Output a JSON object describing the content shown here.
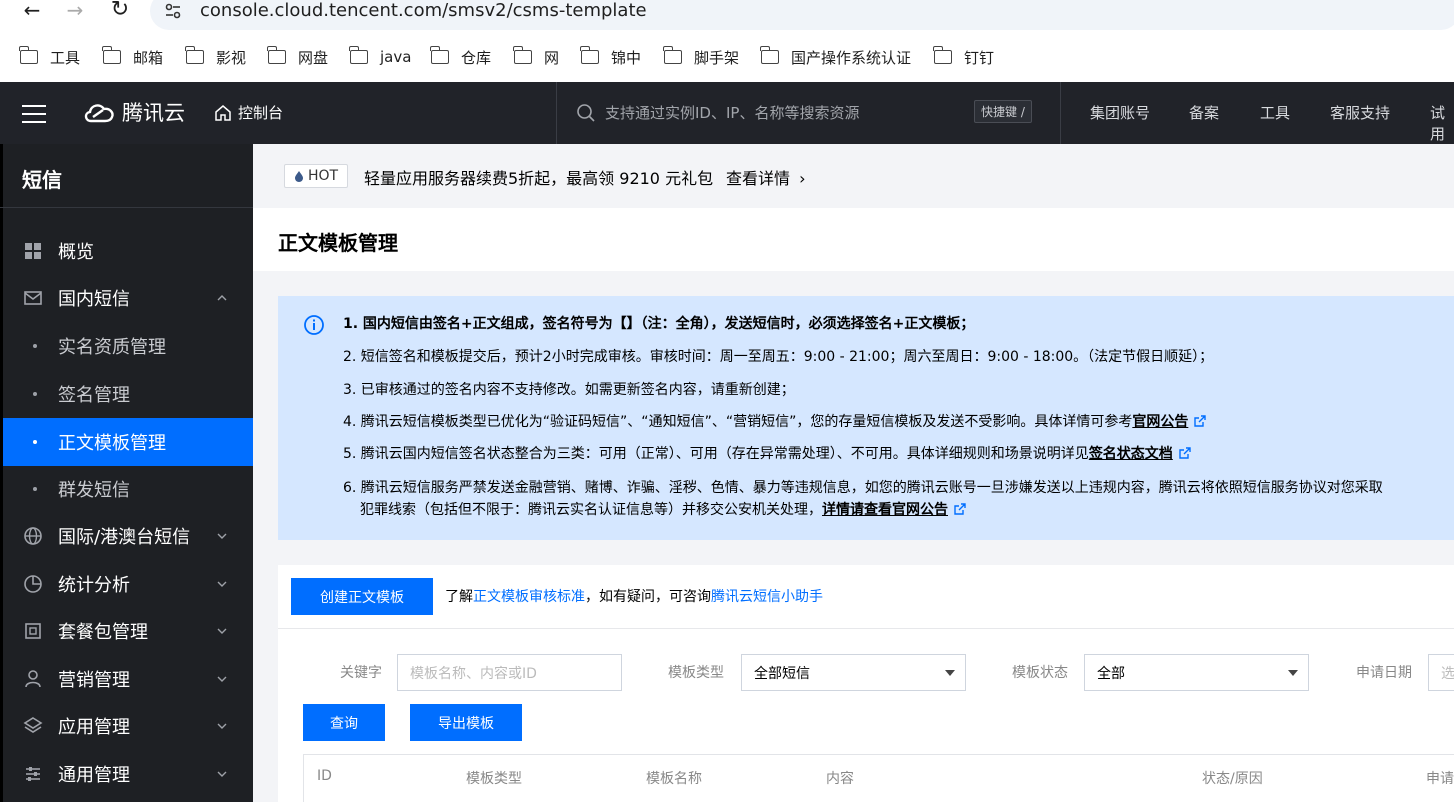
{
  "browser": {
    "url": "console.cloud.tencent.com/smsv2/csms-template",
    "bookmarks": [
      "工具",
      "邮箱",
      "影视",
      "网盘",
      "java",
      "仓库",
      "网",
      "锦中",
      "脚手架",
      "国产操作系统认证",
      "钉钉"
    ]
  },
  "topnav": {
    "brand": "腾讯云",
    "console": "控制台",
    "search_placeholder": "支持通过实例ID、IP、名称等搜索资源",
    "shortcut": "快捷键 /",
    "links": [
      "集团账号",
      "备案",
      "工具",
      "客服支持",
      "试用"
    ]
  },
  "sidebar": {
    "title": "短信",
    "items": [
      {
        "label": "概览",
        "icon": "grid-icon"
      },
      {
        "label": "国内短信",
        "icon": "mail-icon"
      },
      {
        "label": "实名资质管理"
      },
      {
        "label": "签名管理"
      },
      {
        "label": "正文模板管理"
      },
      {
        "label": "群发短信"
      },
      {
        "label": "国际/港澳台短信",
        "icon": "globe-icon"
      },
      {
        "label": "统计分析",
        "icon": "pie-chart-icon"
      },
      {
        "label": "套餐包管理",
        "icon": "package-icon"
      },
      {
        "label": "营销管理",
        "icon": "user-icon"
      },
      {
        "label": "应用管理",
        "icon": "layers-icon"
      },
      {
        "label": "通用管理",
        "icon": "sliders-icon"
      }
    ]
  },
  "banner": {
    "hot_label": "HOT",
    "text": "轻量应用服务器续费5折起，最高领 9210 元礼包",
    "link": "查看详情"
  },
  "page": {
    "title": "正文模板管理"
  },
  "notice": {
    "line1": "1. 国内短信由签名+正文组成，签名符号为【】（注：全角），发送短信时，必须选择签名+正文模板；",
    "line2": "2. 短信签名和模板提交后，预计2小时完成审核。审核时间：周一至周五：9:00 - 21:00；周六至周日：9:00 - 18:00。（法定节假日顺延）；",
    "line3": "3. 已审核通过的签名内容不支持修改。如需更新签名内容，请重新创建；",
    "line4": "4. 腾讯云短信模板类型已优化为“验证码短信”、“通知短信”、“营销短信”，您的存量短信模板及发送不受影响。具体详情可参考",
    "line4_link": "官网公告",
    "line5": "5. 腾讯云国内短信签名状态整合为三类：可用（正常）、可用（存在异常需处理）、不可用。具体详细规则和场景说明详见",
    "line5_link": "签名状态文档",
    "line6a": "6. 腾讯云短信服务严禁发送金融营销、赌博、诈骗、淫秽、色情、暴力等违规信息，如您的腾讯云账号一旦涉嫌发送以上违规内容，腾讯云将依照短信服务协议对您采取",
    "line6b": "犯罪线索（包括但不限于：腾讯云实名认证信息等）并移交公安机关处理，",
    "line6_link": "详情请查看官网公告"
  },
  "toolbar": {
    "create_label": "创建正文模板",
    "help_prefix": "了解",
    "help_link1": "正文模板审核标准",
    "help_mid": "，如有疑问，可咨询",
    "help_link2": "腾讯云短信小助手"
  },
  "filters": {
    "keyword_label": "关键字",
    "keyword_placeholder": "模板名称、内容或ID",
    "type_label": "模板类型",
    "type_value": "全部短信",
    "status_label": "模板状态",
    "status_value": "全部",
    "date_label": "申请日期",
    "date_placeholder": "选",
    "query_label": "查询",
    "export_label": "导出模板"
  },
  "table": {
    "columns": [
      "ID",
      "模板类型",
      "模板名称",
      "内容",
      "状态/原因",
      "申请"
    ]
  },
  "colors": {
    "accent": "#006eff",
    "topnav_bg": "#212329",
    "sidebar_bg": "#1e2024",
    "notice_bg": "#d5e7ff"
  }
}
